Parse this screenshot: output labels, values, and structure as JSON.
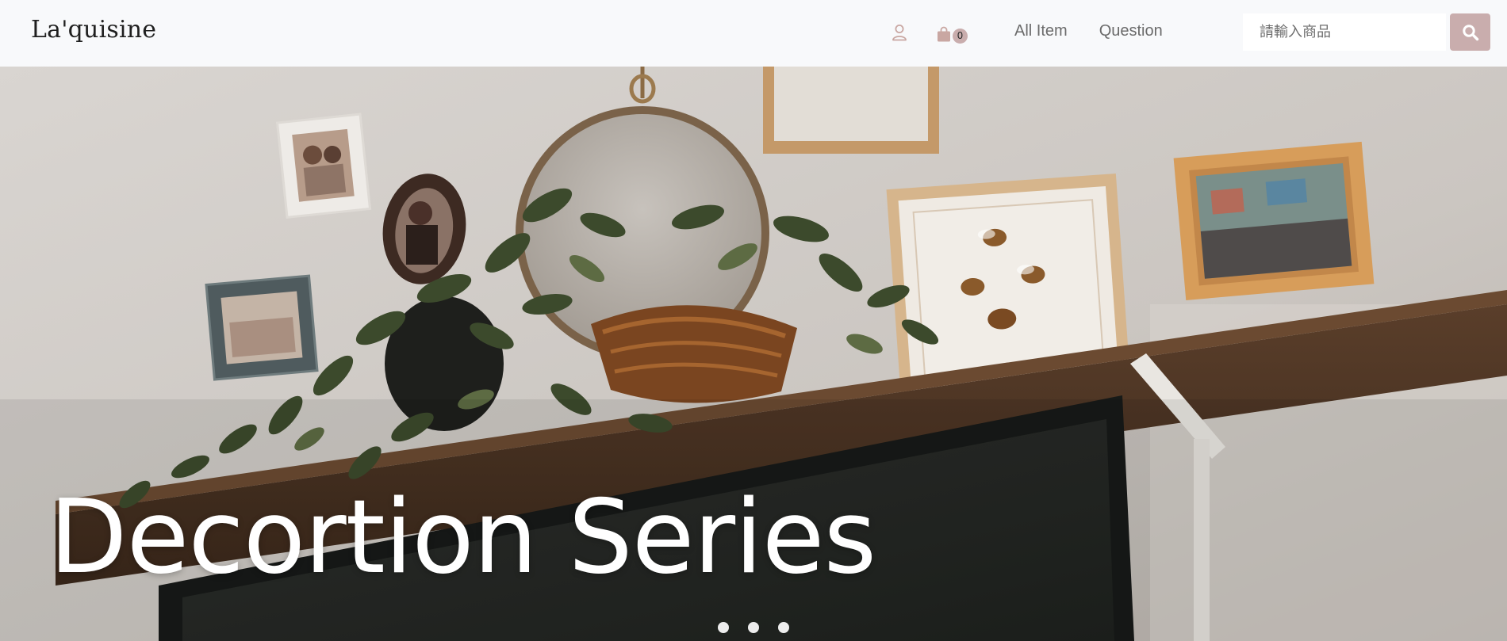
{
  "header": {
    "brand": "La'quisine",
    "user_icon": "user-icon",
    "cart_icon": "shopping-bag-icon",
    "cart_count": "0",
    "nav": [
      {
        "label": "All Item"
      },
      {
        "label": "Question"
      }
    ],
    "search": {
      "placeholder": "請輸入商品",
      "value": "",
      "button_icon": "search-icon"
    }
  },
  "hero": {
    "title": "Decortion Series",
    "slide_count": 3
  },
  "colors": {
    "accent": "#c9adad",
    "navbar_bg": "#f8f9fb",
    "nav_text": "#6b6b6b",
    "hero_text": "#ffffff"
  }
}
